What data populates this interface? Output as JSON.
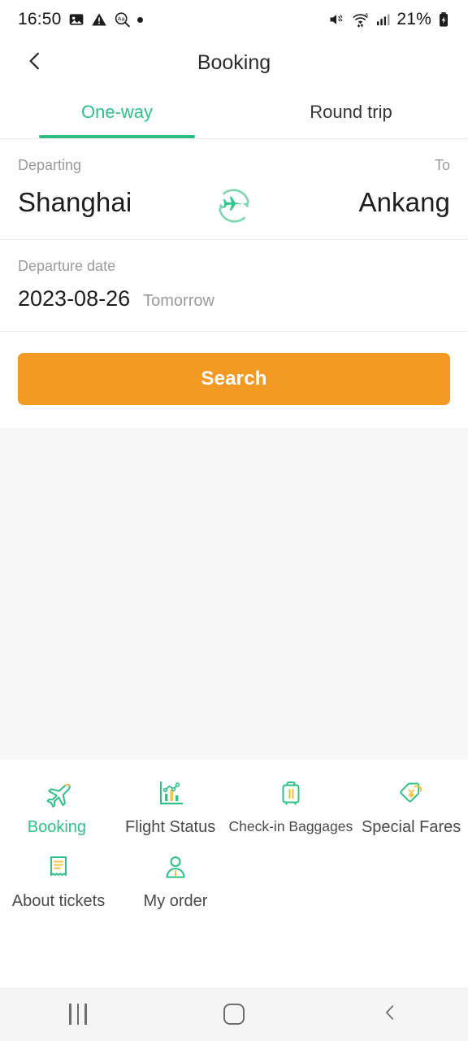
{
  "status_bar": {
    "time": "16:50",
    "battery_percent": "21%",
    "left_icons": [
      "image-icon",
      "warning-triangle-icon",
      "text-magnifier-icon",
      "dot-icon"
    ],
    "right_icons": [
      "volume-mute-icon",
      "wifi-6-icon",
      "cellular-signal-icon",
      "battery-charging-icon"
    ]
  },
  "header": {
    "title": "Booking",
    "back_icon": "chevron-left-icon"
  },
  "tabs": [
    {
      "label": "One-way",
      "active": true
    },
    {
      "label": "Round trip",
      "active": false
    }
  ],
  "search_form": {
    "departing_label": "Departing",
    "to_label": "To",
    "departing_city": "Shanghai",
    "arrival_city": "Ankang",
    "swap_icon": "swap-flight-icon",
    "departure_date_label": "Departure date",
    "departure_date": "2023-08-26",
    "departure_date_relative": "Tomorrow",
    "search_button": "Search"
  },
  "bottom_nav": [
    {
      "label": "Booking",
      "icon": "airplane-icon",
      "active": true
    },
    {
      "label": "Flight Status",
      "icon": "chart-icon",
      "active": false
    },
    {
      "label": "Check-in Baggages",
      "icon": "suitcase-icon",
      "active": false
    },
    {
      "label": "Special Fares",
      "icon": "price-tag-icon",
      "active": false
    },
    {
      "label": "About tickets",
      "icon": "receipt-icon",
      "active": false
    },
    {
      "label": "My order",
      "icon": "user-icon",
      "active": false
    }
  ],
  "android_nav": {
    "recents_icon": "recents-icon",
    "home_icon": "home-icon",
    "back_icon": "back-chevron-icon"
  },
  "colors": {
    "accent_green": "#2ebd85",
    "accent_orange": "#f39a24",
    "accent_yellow": "#f5c242",
    "gray_bg": "#f7f7f7"
  }
}
